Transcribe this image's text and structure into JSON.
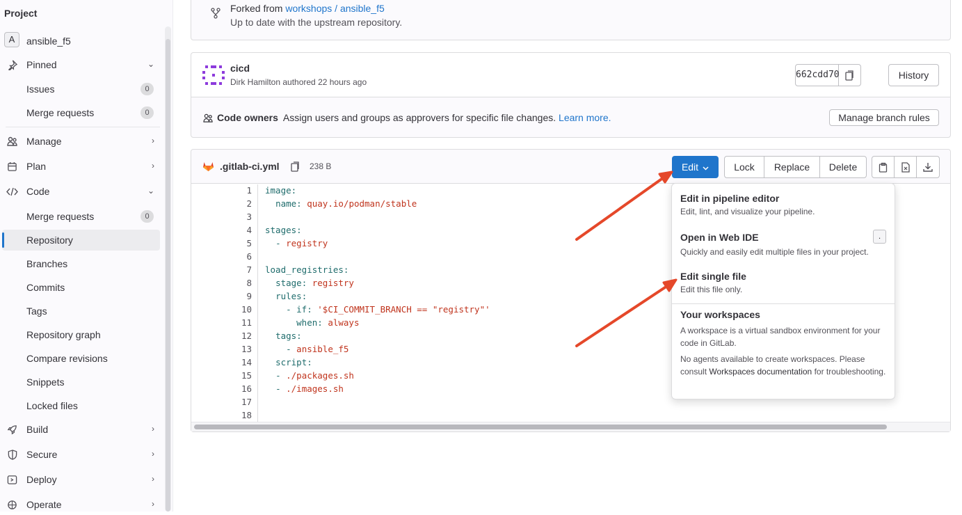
{
  "sidebar": {
    "heading": "Project",
    "project_avatar": "A",
    "project_name": "ansible_f5",
    "items": [
      {
        "label": "Pinned",
        "icon": "pin-icon"
      },
      {
        "label": "Issues",
        "count": "0"
      },
      {
        "label": "Merge requests",
        "count": "0"
      },
      {
        "label": "Manage",
        "icon": "users-icon"
      },
      {
        "label": "Plan",
        "icon": "calendar-icon"
      },
      {
        "label": "Code",
        "icon": "code-icon"
      },
      {
        "label": "Merge requests",
        "count": "0"
      },
      {
        "label": "Repository"
      },
      {
        "label": "Branches"
      },
      {
        "label": "Commits"
      },
      {
        "label": "Tags"
      },
      {
        "label": "Repository graph"
      },
      {
        "label": "Compare revisions"
      },
      {
        "label": "Snippets"
      },
      {
        "label": "Locked files"
      },
      {
        "label": "Build",
        "icon": "rocket-icon"
      },
      {
        "label": "Secure",
        "icon": "shield-icon"
      },
      {
        "label": "Deploy",
        "icon": "deploy-icon"
      },
      {
        "label": "Operate",
        "icon": "operate-icon"
      }
    ]
  },
  "fork": {
    "prefix": "Forked from",
    "link": "workshops / ansible_f5",
    "status": "Up to date with the upstream repository."
  },
  "commit": {
    "title": "cicd",
    "author": "Dirk Hamilton",
    "meta": "authored 22 hours ago",
    "sha": "662cdd70",
    "history_label": "History"
  },
  "code_owners": {
    "label": "Code owners",
    "text": "Assign users and groups as approvers for specific file changes.",
    "link": "Learn more.",
    "button": "Manage branch rules"
  },
  "file": {
    "name": ".gitlab-ci.yml",
    "size": "238 B",
    "edit_label": "Edit",
    "lock_label": "Lock",
    "replace_label": "Replace",
    "delete_label": "Delete"
  },
  "code": {
    "line_numbers": [
      "1",
      "2",
      "3",
      "4",
      "5",
      "6",
      "7",
      "8",
      "9",
      "10",
      "11",
      "12",
      "13",
      "14",
      "15",
      "16",
      "17",
      "18"
    ]
  },
  "dropdown": {
    "pipeline_title": "Edit in pipeline editor",
    "pipeline_desc": "Edit, lint, and visualize your pipeline.",
    "webide_title": "Open in Web IDE",
    "webide_shortcut": ".",
    "webide_desc": "Quickly and easily edit multiple files in your project.",
    "single_title": "Edit single file",
    "single_desc": "Edit this file only.",
    "workspaces_title": "Your workspaces",
    "workspaces_desc1": "A workspace is a virtual sandbox environment for your code in GitLab.",
    "workspaces_desc2_a": "No agents available to create workspaces. Please consult",
    "workspaces_desc2_link": "Workspaces documentation",
    "workspaces_desc2_b": "for troubleshooting."
  },
  "colors": {
    "accent": "#1f75cb",
    "arrow": "#e5482a",
    "link": "#1f75cb"
  }
}
